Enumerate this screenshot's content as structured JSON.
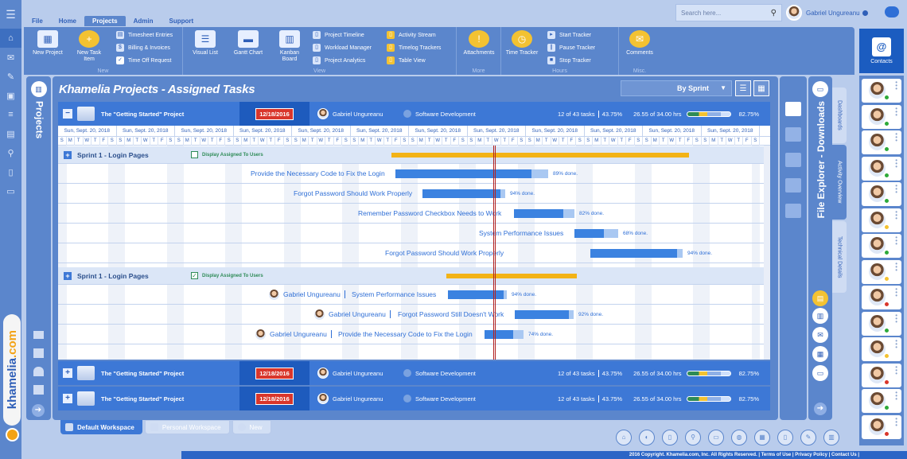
{
  "menu": {
    "tabs": [
      "File",
      "Home",
      "Projects",
      "Admin",
      "Support"
    ],
    "active_tab": "Projects"
  },
  "ribbon": {
    "new": {
      "label": "New",
      "new_project": "New Project",
      "new_task": "New Task Item",
      "timesheet": "Timesheet Entries",
      "billing": "Billing & Invoices",
      "timeoff": "Time Off Request"
    },
    "view": {
      "label": "View",
      "visual_list": "Visual List",
      "gantt": "Gantt Chart",
      "kanban": "Kanban Board",
      "timeline": "Project Timeline",
      "workload": "Workload Manager",
      "analytics": "Project Analytics",
      "activity": "Activity Stream",
      "timelog": "Timelog Trackers",
      "table": "Table View"
    },
    "more": {
      "label": "More",
      "attachments": "Attachments"
    },
    "hours": {
      "label": "Hours",
      "time_tracker": "Time Tracker",
      "start": "Start Tracker",
      "pause": "Pause Tracker",
      "stop": "Stop Tracker"
    },
    "misc": {
      "label": "Misc.",
      "comments": "Comments"
    }
  },
  "search": {
    "placeholder": "Search here..."
  },
  "user": {
    "name": "Gabriel Ungureanu"
  },
  "projects_label": "Projects",
  "main": {
    "title": "Khamelia Projects - Assigned Tasks",
    "group_by": "By Sprint"
  },
  "projects": [
    {
      "title": "The \"Getting Started\" Project",
      "date": "12/18/2016",
      "owner": "Gabriel Ungureanu",
      "dept": "Software Development",
      "tasks": "12 of 43 tasks",
      "pct": "43.75%",
      "hrs": "26.55 of 34.00 hrs",
      "hrs_pct": "82.75%",
      "progress": 0.78
    },
    {
      "title": "The \"Getting Started\" Project",
      "date": "12/18/2016",
      "owner": "Gabriel Ungureanu",
      "dept": "Software Development",
      "tasks": "12 of 43 tasks",
      "pct": "43.75%",
      "hrs": "26.55 of 34.00 hrs",
      "hrs_pct": "82.75%",
      "progress": 0.78
    },
    {
      "title": "The \"Getting Started\" Project",
      "date": "12/18/2016",
      "owner": "Gabriel Ungureanu",
      "dept": "Software Development",
      "tasks": "12 of 43 tasks",
      "pct": "43.75%",
      "hrs": "26.55 of 34.00 hrs",
      "hrs_pct": "82.75%",
      "progress": 0.78
    }
  ],
  "gantt": {
    "week_label": "Sun, Sept. 20, 2018",
    "day_letters": [
      "S",
      "M",
      "T",
      "W",
      "T",
      "F",
      "S"
    ],
    "sprints": [
      {
        "title": "Sprint 1 - Login Pages",
        "assigned_label": "Display Assigned To Users",
        "checked": false,
        "tasks": [
          {
            "name": "Provide the Necessary Code to Fix the Login",
            "pct_label": "89% done.",
            "progress": 0.89
          },
          {
            "name": "Forgot Password Should Work Properly",
            "pct_label": "94% done.",
            "progress": 0.94
          },
          {
            "name": "Remember Password Checkbox Needs to Work",
            "pct_label": "82% done.",
            "progress": 0.82
          },
          {
            "name": "System Performance Issues",
            "pct_label": "68% done.",
            "progress": 0.68
          },
          {
            "name": "Forgot Password Should Work Properly",
            "pct_label": "94% done.",
            "progress": 0.94
          }
        ]
      },
      {
        "title": "Sprint 1 - Login Pages",
        "assigned_label": "Display Assigned To Users",
        "checked": true,
        "tasks": [
          {
            "user": "Gabriel Ungureanu",
            "name": "System Performance Issues",
            "pct_label": "94% done.",
            "progress": 0.94
          },
          {
            "user": "Gabriel Ungureanu",
            "name": "Forgot Password Still Doesn't Work",
            "pct_label": "92% done.",
            "progress": 0.92
          },
          {
            "user": "Gabriel Ungureanu",
            "name": "Provide the Necessary Code to Fix the Login",
            "pct_label": "74% done.",
            "progress": 0.74
          }
        ]
      }
    ]
  },
  "workspaces": [
    "Default Workspace",
    "Personal Workspace",
    "New"
  ],
  "file_explorer": {
    "title": "File Explorer - Downloads",
    "tabs": [
      "Dashboards",
      "Activity Overview",
      "Technical Details"
    ]
  },
  "contacts": {
    "label": "Contacts",
    "status": [
      "#2eaa3a",
      "#2eaa3a",
      "#2eaa3a",
      "#2eaa3a",
      "#2eaa3a",
      "#f3c232",
      "#2eaa3a",
      "#f3c232",
      "#d9362b",
      "#2eaa3a",
      "#f3c232",
      "#d9362b",
      "#2eaa3a",
      "#d9362b"
    ]
  },
  "brand": {
    "name": "khamelia",
    "suffix": ".com"
  },
  "footer": "2016 Copyright. Khamelia.com, Inc. All Rights Reserved. | Terms of Use | Privacy Policy | Contact Us |",
  "colors": {
    "accent": "#5b86cc",
    "row": "#3d78d6",
    "bar": "#3b82e0",
    "sprint_bar": "#f3b316",
    "date_badge": "#d9362b"
  }
}
